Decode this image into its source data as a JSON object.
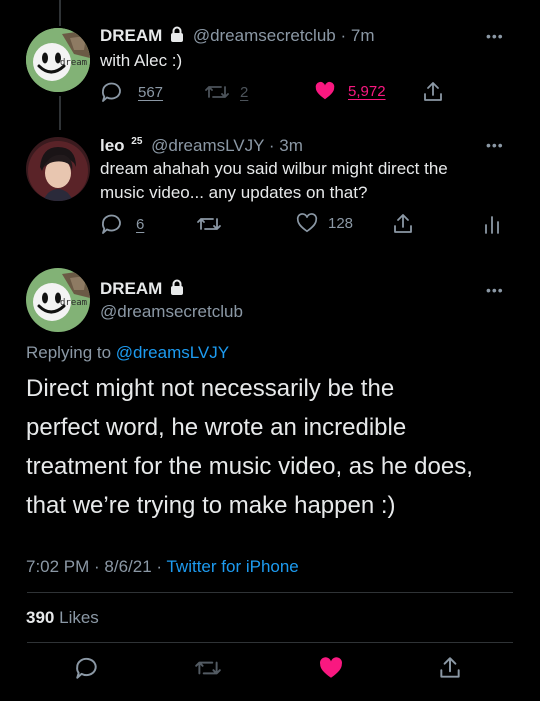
{
  "tweet1": {
    "name": "DREAM",
    "handle": "@dreamsecretclub",
    "time": "· 7m",
    "text": "with Alec :)",
    "replies": "567",
    "retweets": "2",
    "likes": "5,972",
    "avatar_label": "dream"
  },
  "tweet2": {
    "name": "leo",
    "badge": "25",
    "handle": "@dreamsLVJY",
    "time": "· 3m",
    "text_line1": "dream ahahah you said wilbur might direct the",
    "text_line2": "music video... any updates on that?",
    "replies": "6",
    "likes": "128"
  },
  "main": {
    "name": "DREAM",
    "handle": "@dreamsecretclub",
    "avatar_label": "dream",
    "replying_prefix": "Replying to",
    "replying_handle": "@dreamsLVJY",
    "text_line1": "Direct might not necessarily be the",
    "text_line2": "perfect word, he wrote an incredible",
    "text_line3": "treatment for the music video, as he does,",
    "text_line4": "that we’re trying to make happen :)",
    "timestamp": "7:02 PM · 8/6/21 · ",
    "source": "Twitter for iPhone",
    "like_count": "390",
    "like_label": "Likes"
  },
  "more_glyph": "•••",
  "colors": {
    "background": "#000000",
    "text": "#e7e9ea",
    "muted": "#8b98a5",
    "link": "#1d9bf0",
    "like": "#f91880",
    "divider": "#2f3336"
  }
}
